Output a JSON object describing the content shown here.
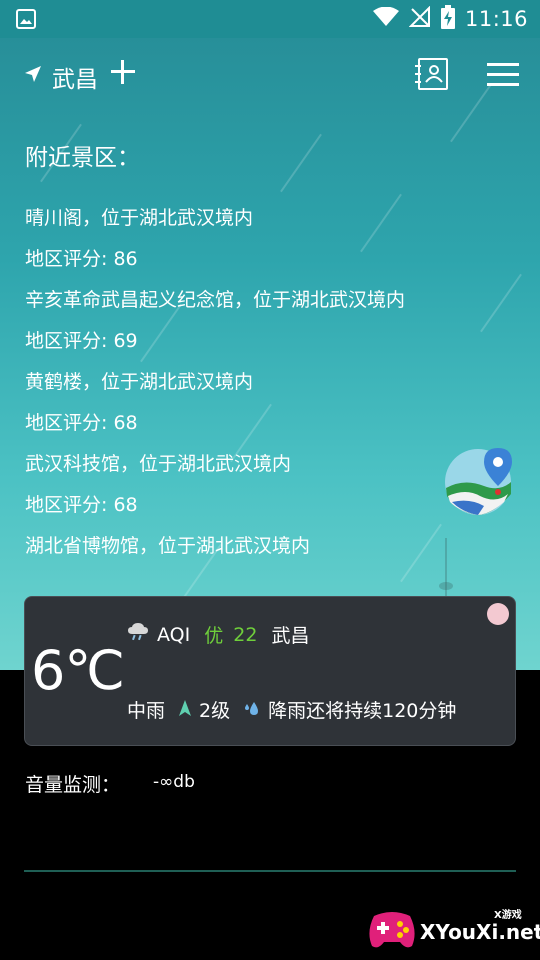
{
  "status_bar": {
    "time": "11:16"
  },
  "header": {
    "location": "武昌"
  },
  "nearby": {
    "title": "附近景区：",
    "lines": [
      "晴川阁，位于湖北武汉境内",
      "地区评分: 86",
      "辛亥革命武昌起义纪念馆，位于湖北武汉境内",
      "地区评分: 69",
      "黄鹤楼，位于湖北武汉境内",
      "地区评分: 68",
      "武汉科技馆，位于湖北武汉境内",
      "地区评分: 68",
      "湖北省博物馆，位于湖北武汉境内"
    ]
  },
  "weather": {
    "temperature": "6℃",
    "aqi_label": "AQI",
    "aqi_level": "优",
    "aqi_value": "22",
    "district": "武昌",
    "condition": "中雨",
    "wind": "2级",
    "forecast": "降雨还将持续120分钟"
  },
  "volume": {
    "label": "音量监测：",
    "value": "-∞db"
  },
  "watermark": {
    "site": "XYouXi.net",
    "tag": "X游戏"
  },
  "colors": {
    "hero_top": "#278f99",
    "hero_bottom": "#6fd4cf",
    "card": "#2f3338",
    "aqi_green": "#6fcf3b"
  }
}
